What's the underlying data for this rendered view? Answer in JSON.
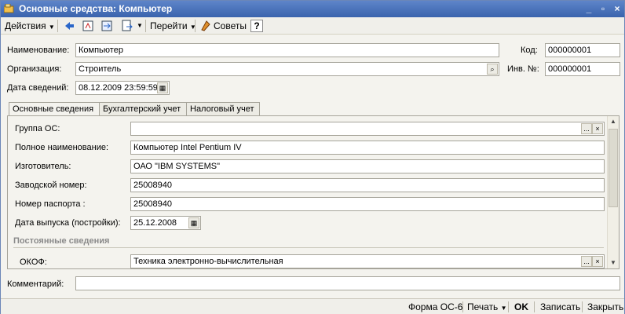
{
  "window": {
    "title": "Основные средства: Компьютер",
    "minimize": "_",
    "restore": "▫",
    "close": "×"
  },
  "toolbar": {
    "actions_label": "Действия",
    "goto_label": "Перейти",
    "advice_label": "Советы",
    "help_label": "?"
  },
  "header": {
    "name_label": "Наименование:",
    "name_value": "Компьютер",
    "code_label": "Код:",
    "code_value": "000000001",
    "org_label": "Организация:",
    "org_value": "Строитель",
    "inv_label": "Инв. №:",
    "inv_value": "000000001",
    "date_label": "Дата сведений:",
    "date_value": "08.12.2009 23:59:59"
  },
  "tabs": [
    {
      "label": "Основные сведения"
    },
    {
      "label": "Бухгалтерский учет"
    },
    {
      "label": "Налоговый учет"
    }
  ],
  "main": {
    "group_label": "Группа ОС:",
    "group_value": "",
    "fullname_label": "Полное наименование:",
    "fullname_value": "Компьютер Intel Pentium IV",
    "maker_label": "Изготовитель:",
    "maker_value": "ОАО \"IBM SYSTEMS\"",
    "serial_label": "Заводской номер:",
    "serial_value": "25008940",
    "passport_label": "Номер паспорта :",
    "passport_value": "25008940",
    "release_label": "Дата выпуска (постройки):",
    "release_value": "25.12.2008",
    "section_title": "Постоянные сведения",
    "okof_label": "ОКОФ:",
    "okof_value": "Техника электронно-вычислительная"
  },
  "comment": {
    "label": "Комментарий:",
    "value": ""
  },
  "statusbar": {
    "form_label": "Форма ОС-6",
    "print_label": "Печать",
    "ok_label": "OK",
    "save_label": "Записать",
    "close_label": "Закрыть"
  },
  "icons": {
    "select": "...",
    "clear": "×",
    "search": "⌕"
  }
}
